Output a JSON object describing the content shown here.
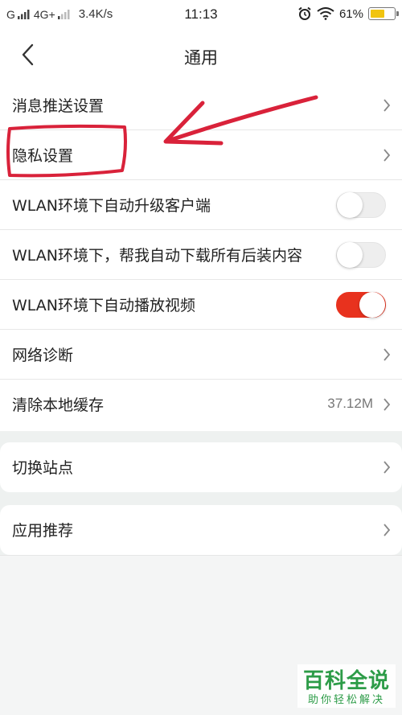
{
  "status_bar": {
    "carrier_g": "G",
    "network_4g": "4G+",
    "speed": "3.4K/s",
    "time": "11:13",
    "battery_percent": "61%",
    "battery_level": 0.61,
    "battery_color": "#f1c40f"
  },
  "navbar": {
    "title": "通用",
    "back_icon": "chevron-left-icon"
  },
  "settings": {
    "items": [
      {
        "label": "消息推送设置",
        "control": "chevron"
      },
      {
        "label": "隐私设置",
        "control": "chevron"
      },
      {
        "label": "WLAN环境下自动升级客户端",
        "control": "toggle",
        "on": false
      },
      {
        "label": "WLAN环境下，帮我自动下载所有后装内容",
        "control": "toggle",
        "on": false
      },
      {
        "label": "WLAN环境下自动播放视频",
        "control": "toggle",
        "on": true
      },
      {
        "label": "网络诊断",
        "control": "chevron"
      },
      {
        "label": "清除本地缓存",
        "control": "chevron",
        "value": "37.12M"
      }
    ],
    "switch_site": {
      "label": "切换站点"
    },
    "app_recommend": {
      "label": "应用推荐"
    }
  },
  "colors": {
    "toggle_on": "#e8321e",
    "annotation": "#d9223a",
    "watermark": "#2d9c48"
  },
  "watermark": {
    "main": "百科全说",
    "sub": "助你轻松解决"
  }
}
